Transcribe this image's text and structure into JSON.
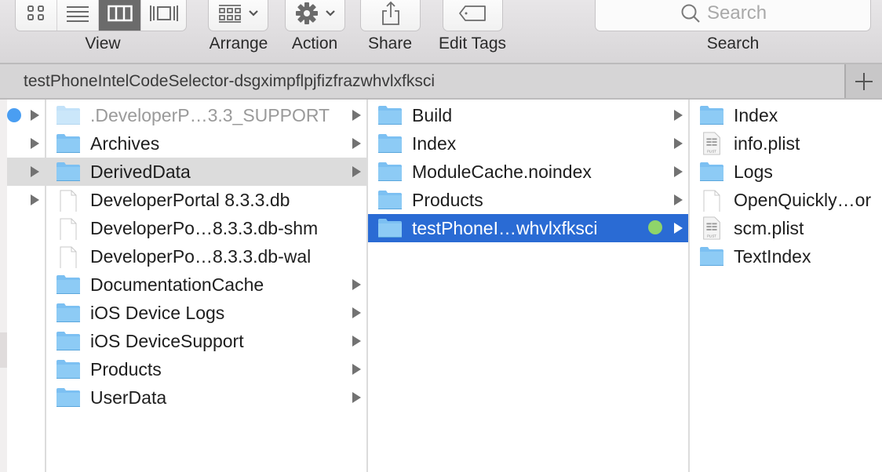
{
  "toolbar": {
    "view_label": "View",
    "view_modes": [
      {
        "name": "icon-view",
        "active": false
      },
      {
        "name": "list-view",
        "active": false
      },
      {
        "name": "column-view",
        "active": true
      },
      {
        "name": "cover-flow-view",
        "active": false
      }
    ],
    "arrange_label": "Arrange",
    "action_label": "Action",
    "share_label": "Share",
    "edit_tags_label": "Edit Tags",
    "search_placeholder": "Search",
    "search_label": "Search"
  },
  "pathbar": {
    "title": "testPhoneIntelCodeSelector-dsgximpflpjfizfrazwhvlxfksci",
    "add_tab_icon": "plus-icon"
  },
  "columns": [
    {
      "items": [
        {
          "name": ".DeveloperP…3.3_SUPPORT",
          "type": "folder",
          "dim": true,
          "has_children": true,
          "tag_dot": "#4a9ef2"
        },
        {
          "name": "Archives",
          "type": "folder",
          "has_children": true
        },
        {
          "name": "DerivedData",
          "type": "folder",
          "has_children": true,
          "selected": "inactive"
        },
        {
          "name": "DeveloperPortal 8.3.3.db",
          "type": "file",
          "has_children": false
        },
        {
          "name": "DeveloperPo…8.3.3.db-shm",
          "type": "file",
          "has_children": false
        },
        {
          "name": "DeveloperPo…8.3.3.db-wal",
          "type": "file",
          "has_children": false
        },
        {
          "name": "DocumentationCache",
          "type": "folder",
          "has_children": true
        },
        {
          "name": "iOS Device Logs",
          "type": "folder",
          "has_children": true
        },
        {
          "name": "iOS DeviceSupport",
          "type": "folder",
          "has_children": true
        },
        {
          "name": "Products",
          "type": "folder",
          "has_children": true
        },
        {
          "name": "UserData",
          "type": "folder",
          "has_children": true
        }
      ]
    },
    {
      "items": [
        {
          "name": "Build",
          "type": "folder",
          "has_children": true
        },
        {
          "name": "Index",
          "type": "folder",
          "has_children": true
        },
        {
          "name": "ModuleCache.noindex",
          "type": "folder",
          "has_children": true
        },
        {
          "name": "Products",
          "type": "folder",
          "has_children": true
        },
        {
          "name": "testPhoneI…whvlxfksci",
          "type": "folder",
          "has_children": true,
          "selected": "active",
          "tag_dot": "#8fd46a"
        }
      ]
    },
    {
      "items": [
        {
          "name": "Index",
          "type": "folder"
        },
        {
          "name": "info.plist",
          "type": "plist"
        },
        {
          "name": "Logs",
          "type": "folder"
        },
        {
          "name": "OpenQuickly…or",
          "type": "file"
        },
        {
          "name": "scm.plist",
          "type": "plist"
        },
        {
          "name": "TextIndex",
          "type": "folder"
        }
      ]
    }
  ],
  "colors": {
    "selection_active": "#2a6bd4",
    "selection_inactive": "#dcdcdc",
    "folder": "#7cc0f2",
    "blue_tag": "#4a9ef2",
    "green_tag": "#8fd46a"
  }
}
